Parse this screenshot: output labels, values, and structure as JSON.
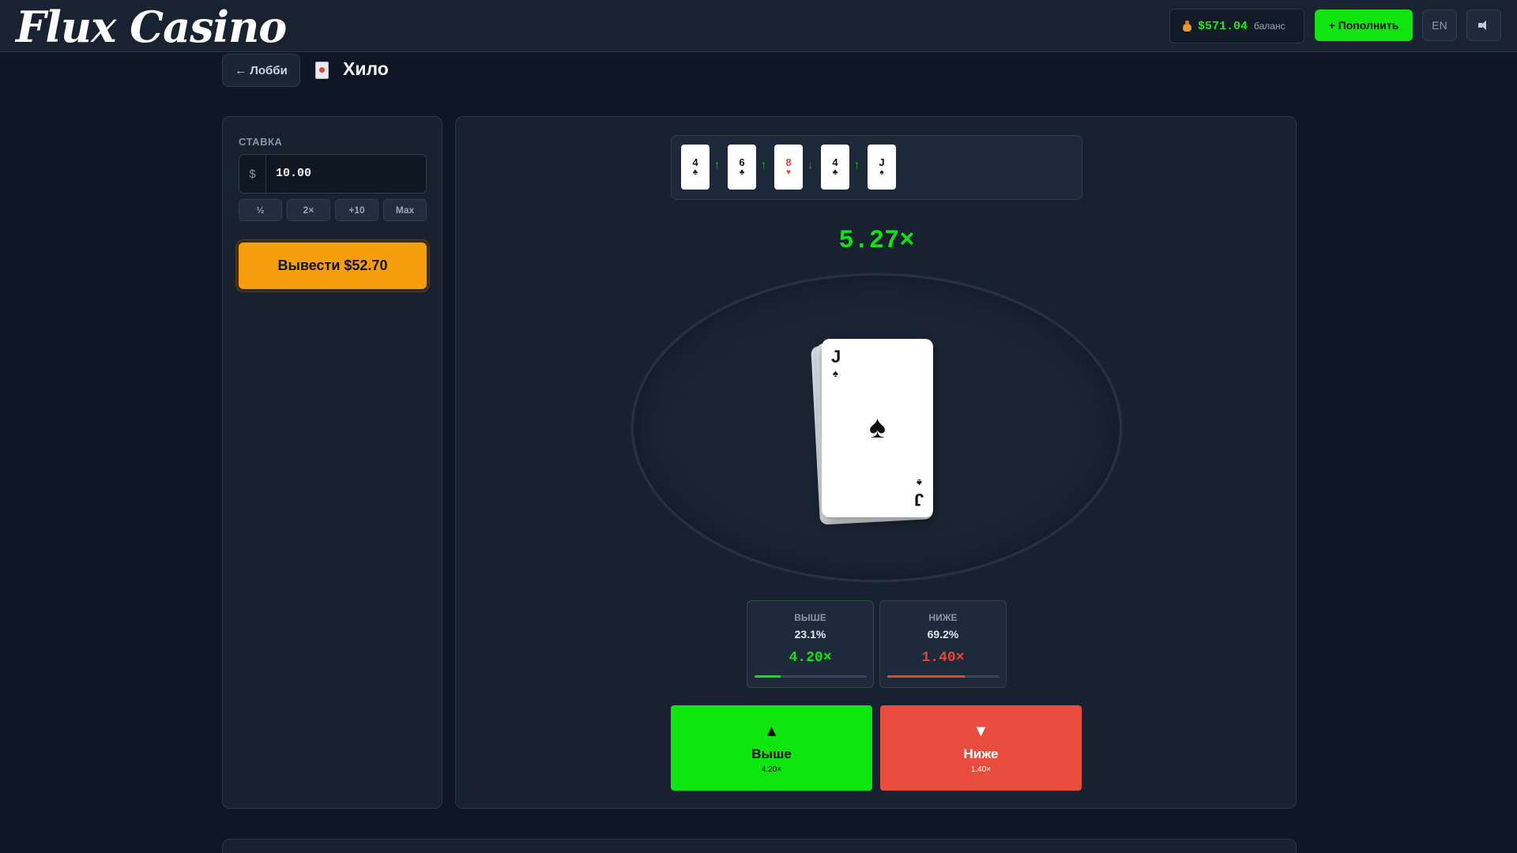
{
  "header": {
    "logo": "Flux Casino",
    "balance_amount": "$571.04",
    "balance_label": "баланс",
    "deposit_label": "+ Пополнить",
    "lang": "EN"
  },
  "title_row": {
    "back_label": "← Лобби",
    "game_title": "Хило"
  },
  "bet_panel": {
    "label": "СТАВКА",
    "currency": "$",
    "value": "10.00",
    "chips": [
      "½",
      "2×",
      "+10",
      "Max"
    ],
    "cashout_label": "Вывести $52.70"
  },
  "game": {
    "history": [
      {
        "rank": "4",
        "suit": "♣",
        "color": "black"
      },
      {
        "arrow": "↑",
        "dir": "up"
      },
      {
        "rank": "6",
        "suit": "♣",
        "color": "black"
      },
      {
        "arrow": "↑",
        "dir": "up"
      },
      {
        "rank": "8",
        "suit": "♥",
        "color": "red"
      },
      {
        "arrow": "↓",
        "dir": "down"
      },
      {
        "rank": "4",
        "suit": "♣",
        "color": "black"
      },
      {
        "arrow": "↑",
        "dir": "up"
      },
      {
        "rank": "J",
        "suit": "♠",
        "color": "black"
      }
    ],
    "multiplier": "5.27×",
    "current_card": {
      "rank": "J",
      "suit": "♠"
    },
    "higher": {
      "label": "ВЫШЕ",
      "pct": "23.1%",
      "mult": "4.20×",
      "fill": 0.231
    },
    "lower": {
      "label": "НИЖЕ",
      "pct": "69.2%",
      "mult": "1.40×",
      "fill": 0.692
    },
    "higher_btn": {
      "arrow": "▲",
      "label": "Выше",
      "sub": "4.20×"
    },
    "lower_btn": {
      "arrow": "▼",
      "label": "Ниже",
      "sub": "1.40×"
    }
  },
  "colors": {
    "accent_green": "#15e015",
    "accent_red": "#e0463a",
    "cashout_orange": "#f59d0b"
  }
}
